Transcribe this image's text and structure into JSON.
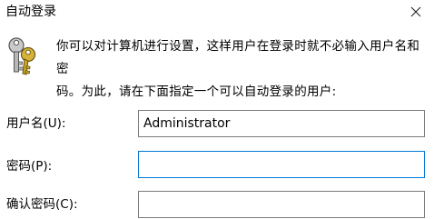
{
  "dialog": {
    "title": "自动登录",
    "message_line1": "你可以对计算机进行设置，这样用户在登录时就不必输入用户名和密",
    "message_line2": "码。为此，请在下面指定一个可以自动登录的用户:"
  },
  "icons": {
    "close": "close-icon",
    "keys": "keys-icon"
  },
  "form": {
    "username_label": "用户名(U):",
    "username_value": "Administrator",
    "password_label": "密码(P):",
    "password_value": "",
    "confirm_label": "确认密码(C):",
    "confirm_value": ""
  },
  "colors": {
    "focus_border": "#0078d7",
    "field_border": "#7a7a7a",
    "key_gold": "#d6b43a"
  }
}
